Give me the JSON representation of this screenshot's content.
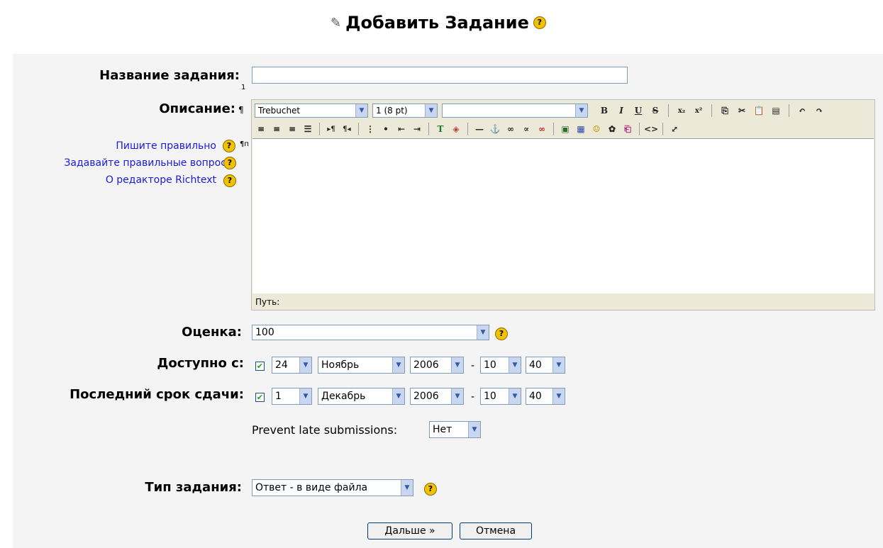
{
  "header": {
    "title": "Добавить Задание"
  },
  "fields": {
    "name_label": "Название задания:",
    "name_value": "",
    "description_label": "Описание:",
    "grade_label": "Оценка:",
    "available_label": "Доступно с:",
    "due_label": "Последний срок сдачи:",
    "prevent_late_label": "Prevent late submissions:",
    "type_label": "Тип задания:"
  },
  "help_links": [
    {
      "label": "Пишите правильно"
    },
    {
      "label": "Задавайте правильные вопросы"
    },
    {
      "label": "О редакторе Richtext"
    }
  ],
  "editor": {
    "font": "Trebuchet",
    "size": "1 (8 pt)",
    "style": "",
    "path_label": "Путь:",
    "row1_icons": [
      "bold-icon",
      "italic-icon",
      "underline-icon",
      "strikethrough-icon",
      "subscript-icon",
      "superscript-icon",
      "copy-icon",
      "cut-icon",
      "paste-icon",
      "paste-word-icon",
      "undo-icon",
      "redo-icon"
    ],
    "row2_icons": [
      "align-left-icon",
      "align-center-icon",
      "align-right-icon",
      "justify-icon",
      "ltr-icon",
      "rtl-icon",
      "ordered-list-icon",
      "unordered-list-icon",
      "outdent-icon",
      "indent-icon",
      "text-color-icon",
      "background-color-icon",
      "horizontal-rule-icon",
      "anchor-icon",
      "link-icon",
      "unlink-icon",
      "nolink-icon",
      "image-icon",
      "table-icon",
      "smiley-icon",
      "special-char-icon",
      "search-replace-icon",
      "html-source-icon",
      "fullscreen-icon"
    ]
  },
  "grade": {
    "value": "100"
  },
  "available": {
    "checked": true,
    "day": "24",
    "month": "Ноябрь",
    "year": "2006",
    "hour": "10",
    "minute": "40"
  },
  "due": {
    "checked": true,
    "day": "1",
    "month": "Декабрь",
    "year": "2006",
    "hour": "10",
    "minute": "40"
  },
  "prevent_late": {
    "value": "Нет"
  },
  "assignment_type": {
    "value": "Ответ - в виде файла"
  },
  "buttons": {
    "next": "Дальше »",
    "cancel": "Отмена"
  },
  "side_fragments": {
    "a": "1",
    "b": "¶",
    "c": "¶п"
  }
}
